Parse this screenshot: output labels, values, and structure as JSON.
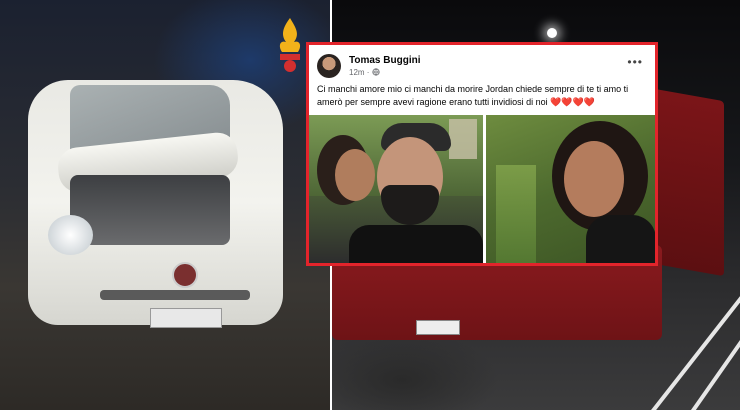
{
  "post": {
    "author": "Tomas Buggini",
    "time": "12m",
    "audience_icon": "globe-icon",
    "more_label": "•••",
    "text": "Ci manchi amore mio ci manchi da morire Jordan chiede sempre di te ti amo ti amerò per sempre avevi ragione erano tutti invidiosi di noi ❤️❤️❤️❤️"
  },
  "colors": {
    "highlight_border": "#e3242b",
    "bus_red": "#8a1a1e"
  }
}
